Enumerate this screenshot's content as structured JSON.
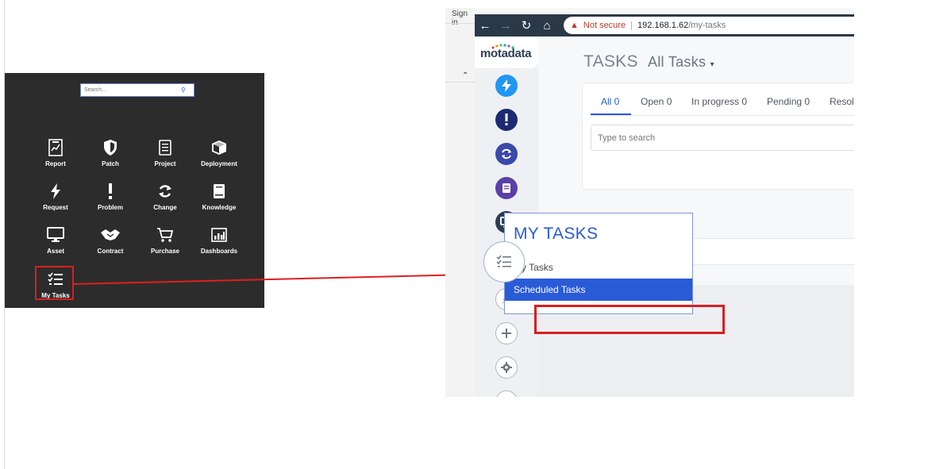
{
  "left_panel": {
    "search_placeholder": "Search...",
    "items": [
      {
        "label": "Report",
        "icon": "report-icon"
      },
      {
        "label": "Patch",
        "icon": "shield-icon"
      },
      {
        "label": "Project",
        "icon": "document-icon"
      },
      {
        "label": "Deployment",
        "icon": "box-icon"
      },
      {
        "label": "Request",
        "icon": "lightning-icon"
      },
      {
        "label": "Problem",
        "icon": "exclamation-icon"
      },
      {
        "label": "Change",
        "icon": "sync-icon"
      },
      {
        "label": "Knowledge",
        "icon": "book-icon"
      },
      {
        "label": "Asset",
        "icon": "monitor-icon"
      },
      {
        "label": "Contract",
        "icon": "handshake-icon"
      },
      {
        "label": "Purchase",
        "icon": "cart-icon"
      },
      {
        "label": "Dashboards",
        "icon": "chart-icon"
      },
      {
        "label": "My Tasks",
        "icon": "checklist-icon"
      }
    ]
  },
  "background_page": {
    "sign_in": "Sign in"
  },
  "browser": {
    "not_secure": "Not secure",
    "url_host": "192.168.1.62",
    "url_path": "/my-tasks"
  },
  "app": {
    "logo": "motadata",
    "title": "TASKS",
    "view_selector": "All Tasks",
    "tabs": [
      {
        "label": "All 0",
        "active": true
      },
      {
        "label": "Open 0"
      },
      {
        "label": "In progress 0"
      },
      {
        "label": "Pending 0"
      },
      {
        "label": "Resol"
      }
    ],
    "search_placeholder": "Type to search",
    "flyout": {
      "title": "MY TASKS",
      "items": [
        "My Tasks",
        "Scheduled Tasks"
      ]
    }
  },
  "colors": {
    "accent": "#2a5bd7",
    "highlight": "#d81f1f",
    "dark_panel": "#2c2c2c",
    "browser_bar": "#2b3848"
  }
}
